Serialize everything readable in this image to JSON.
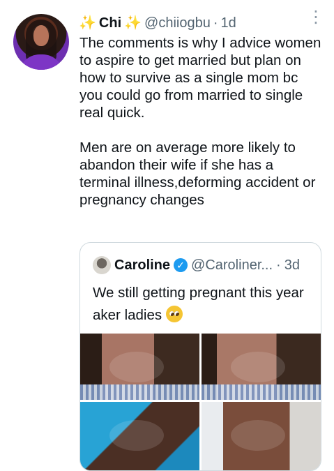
{
  "tweet": {
    "name_prefix": "✨",
    "name": "Chi",
    "name_suffix": "✨",
    "handle": "@chiiogbu",
    "separator": "·",
    "time": "1d",
    "more_icon": "vertical-ellipsis-icon",
    "text": "The comments is why I advice women to aspire to get married but plan on how to survive as a single mom bc you could go from married to single real quick.\n\nMen are on average more likely to abandon their wife if she has a terminal illness,deforming accident or pregnancy changes"
  },
  "quote": {
    "name": "Caroline",
    "handle": "@Caroliner...",
    "separator": "·",
    "time": "3d",
    "verified_icon": "verified-check-icon",
    "text": "We still getting pregnant this year aker ladies"
  },
  "colors": {
    "text": "#0f1419",
    "secondary": "#536471",
    "border": "#cfd9de",
    "verified": "#1d9bf0",
    "sparkle": "#f2c94c"
  }
}
